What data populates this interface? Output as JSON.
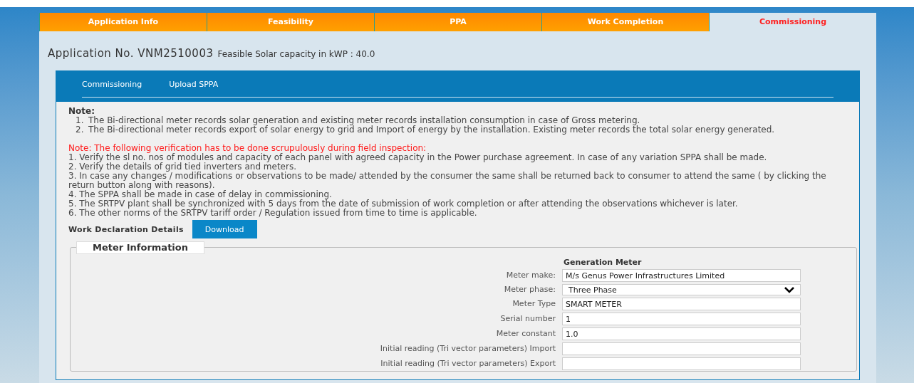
{
  "tabs": [
    {
      "label": "Application Info",
      "selected": false
    },
    {
      "label": "Feasibility",
      "selected": false
    },
    {
      "label": "PPA",
      "selected": false
    },
    {
      "label": "Work Completion",
      "selected": false
    },
    {
      "label": "Commissioning",
      "selected": true
    }
  ],
  "application": {
    "label": "Application No.",
    "number": "VNM2510003",
    "capacity": "Feasible Solar capacity in kWP : 40.0"
  },
  "subtabs": [
    "Commissioning",
    "Upload SPPA"
  ],
  "note": {
    "title": "Note:",
    "items": [
      {
        "number": "1.",
        "text": "The Bi-directional meter records solar generation and existing meter records installation consumption in case of Gross metering."
      },
      {
        "number": "2.",
        "text": "The Bi-directional meter records export of solar energy to grid and Import of energy by the installation. Existing meter records the total solar energy generated."
      }
    ]
  },
  "verification": {
    "title": "Note: The following verification has to be done scrupulously during field inspection:",
    "items": [
      "1. Verify the sl no. nos of modules and capacity of each panel with agreed capacity in the Power purchase agreement. In case of any variation SPPA shall be made.",
      "2. Verify the details of grid tied inverters and meters.",
      "3. In case any changes / modifications or observations to be made/ attended by the consumer the same shall be returned back to consumer to attend the same ( by clicking the return button along with reasons).",
      "4. The SPPA shall be made in case of delay in commissioning.",
      "5. The SRTPV plant shall be synchronized with 5 days from the date of submission of work completion or after attending the observations whichever is later.",
      "6. The other norms of the SRTPV tariff order / Regulation issued from time to time is applicable."
    ]
  },
  "declaration": {
    "label": "Work Declaration Details",
    "button": "Download"
  },
  "meter_info": {
    "legend": "Meter Information",
    "column": "Generation Meter",
    "fields": [
      {
        "label": "Meter make:",
        "kind": "text",
        "value": "M/s Genus Power Infrastructures Limited"
      },
      {
        "label": "Meter phase:",
        "kind": "select",
        "value": "Three Phase"
      },
      {
        "label": "Meter Type",
        "kind": "text",
        "value": "SMART METER"
      },
      {
        "label": "Serial number",
        "kind": "text",
        "value": "1"
      },
      {
        "label": "Meter constant",
        "kind": "text",
        "value": "1.0"
      },
      {
        "label": "Initial reading (Tri vector parameters) Import",
        "kind": "text"
      },
      {
        "label": "Initial reading (Tri vector parameters) Export",
        "kind": "text"
      }
    ]
  }
}
